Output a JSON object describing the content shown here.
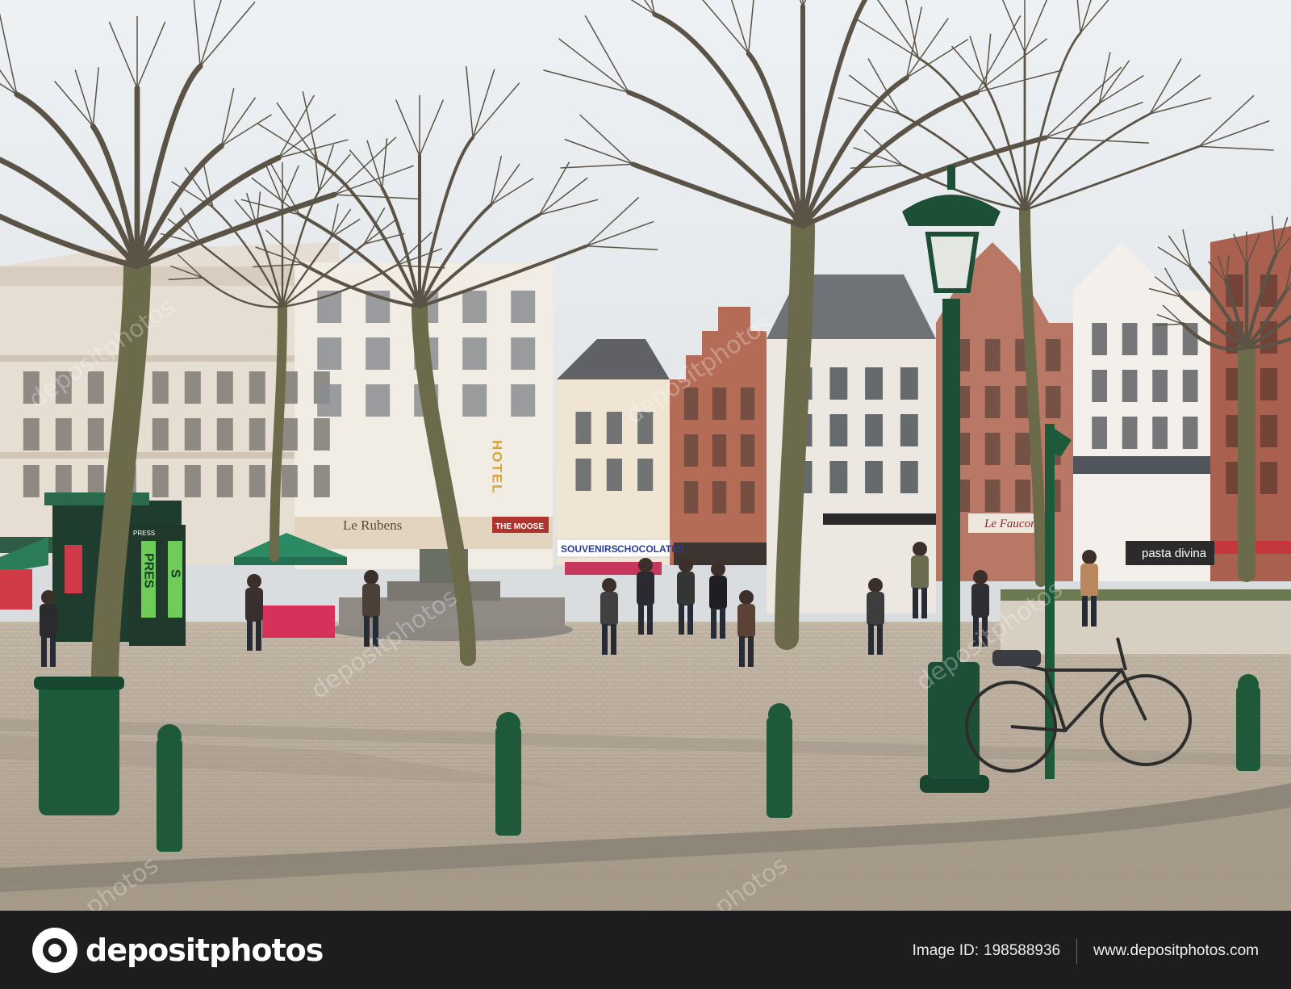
{
  "signs": {
    "hotel": "HOTEL",
    "le_rubens": "Le Rubens",
    "souvenirs": "SOUVENIRS",
    "chocolates": "CHOCOLATES",
    "le_faucon": "Le Faucon",
    "pasta_divina": "pasta divina",
    "press": "PRESS",
    "press_vertical_left": "PRES",
    "press_vertical_right": "S",
    "the_moose": "THE MOOSE"
  },
  "watermark": {
    "text": "depositphotos",
    "repeat_fragment": "photos"
  },
  "footer": {
    "brand": "depositphotos",
    "image_id_label": "Image ID:",
    "image_id": "198588936",
    "site": "www.depositphotos.com"
  },
  "colors": {
    "sky": "#e4e8ec",
    "cobblestone": "#b9aea0",
    "green_street_furniture": "#1f5a3a",
    "footer_bg": "#1d1d1f"
  }
}
